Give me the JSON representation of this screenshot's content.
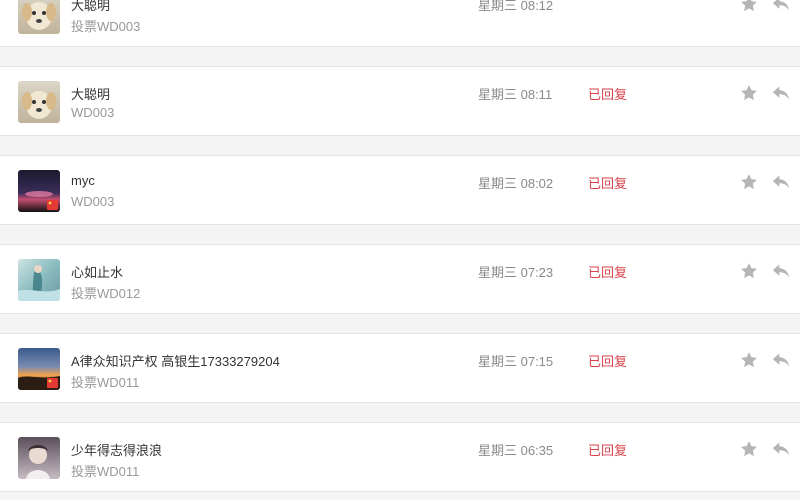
{
  "messages": [
    {
      "name": "大聪明",
      "subject": "投票WD003",
      "time": "星期三 08:12",
      "status": "",
      "avatar": "dog-avatar",
      "badge": false
    },
    {
      "name": "大聪明",
      "subject": "WD003",
      "time": "星期三 08:11",
      "status": "已回复",
      "avatar": "dog-avatar",
      "badge": false
    },
    {
      "name": "myc",
      "subject": "WD003",
      "time": "星期三 08:02",
      "status": "已回复",
      "avatar": "night-avatar",
      "badge": true
    },
    {
      "name": "心如止水",
      "subject": "投票WD012",
      "time": "星期三 07:23",
      "status": "已回复",
      "avatar": "water-avatar",
      "badge": false
    },
    {
      "name": "A律众知识产权 高银生17333279204",
      "subject": "投票WD011",
      "time": "星期三 07:15",
      "status": "已回复",
      "avatar": "sunset-avatar",
      "badge": true
    },
    {
      "name": "少年得志得浪浪",
      "subject": "投票WD011",
      "time": "星期三 06:35",
      "status": "已回复",
      "avatar": "child-avatar",
      "badge": false
    }
  ],
  "icons": {
    "star": "star-icon",
    "reply": "reply-icon"
  },
  "colors": {
    "status": "#d9424a",
    "icon": "#b5b5b5"
  }
}
